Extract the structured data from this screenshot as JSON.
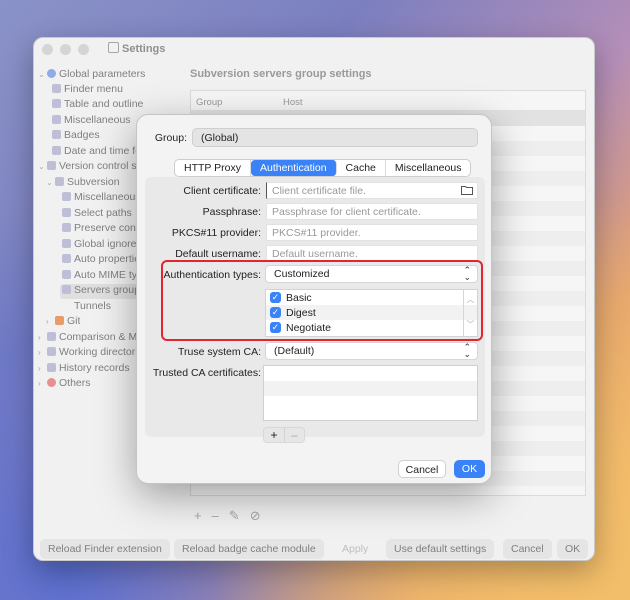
{
  "window": {
    "title": "Settings",
    "content_title": "Subversion servers group settings",
    "table_columns": [
      "Group",
      "Host"
    ],
    "table_tools": [
      "+",
      "–",
      "✎",
      "⊘"
    ]
  },
  "sidebar": {
    "items": [
      {
        "label": "Global parameters",
        "chevron": "⌄"
      },
      {
        "label": "Finder menu",
        "chevron": ""
      },
      {
        "label": "Table and outline",
        "chevron": ""
      },
      {
        "label": "Miscellaneous",
        "chevron": ""
      },
      {
        "label": "Badges",
        "chevron": ""
      },
      {
        "label": "Date and time fo",
        "chevron": ""
      },
      {
        "label": "Version control sy",
        "chevron": "⌄"
      },
      {
        "label": "Subversion",
        "chevron": "⌄"
      },
      {
        "label": "Miscellaneous",
        "chevron": ""
      },
      {
        "label": "Select paths",
        "chevron": ""
      },
      {
        "label": "Preserve conf",
        "chevron": ""
      },
      {
        "label": "Global ignore",
        "chevron": ""
      },
      {
        "label": "Auto propertie",
        "chevron": ""
      },
      {
        "label": "Auto MIME typ",
        "chevron": ""
      },
      {
        "label": "Servers group",
        "chevron": ""
      },
      {
        "label": "Tunnels",
        "chevron": ""
      },
      {
        "label": "Git",
        "chevron": "›"
      },
      {
        "label": "Comparison & Me",
        "chevron": "›"
      },
      {
        "label": "Working directorie",
        "chevron": "›"
      },
      {
        "label": "History records",
        "chevron": "›"
      },
      {
        "label": "Others",
        "chevron": "›"
      }
    ]
  },
  "bottom_bar": {
    "reload_finder": "Reload Finder extension",
    "reload_badge": "Reload badge cache module",
    "apply": "Apply",
    "use_default": "Use default settings",
    "cancel": "Cancel",
    "ok": "OK"
  },
  "sheet": {
    "group_label": "Group:",
    "group_value": "(Global)",
    "tabs": [
      "HTTP Proxy",
      "Authentication",
      "Cache",
      "Miscellaneous"
    ],
    "active_tab": "Authentication",
    "client_cert_label": "Client certificate:",
    "client_cert_placeholder": "Client certificate file.",
    "passphrase_label": "Passphrase:",
    "passphrase_placeholder": "Passphrase for client certificate.",
    "pkcs_label": "PKCS#11 provider:",
    "pkcs_placeholder": "PKCS#11 provider.",
    "username_label": "Default username:",
    "username_placeholder": "Default username.",
    "auth_types_label": "Authentication types:",
    "auth_types_value": "Customized",
    "auth_options": [
      {
        "label": "Basic",
        "checked": true
      },
      {
        "label": "Digest",
        "checked": true
      },
      {
        "label": "Negotiate",
        "checked": true
      }
    ],
    "trust_ca_label": "Truse system CA:",
    "trust_ca_value": "(Default)",
    "trusted_certs_label": "Trusted CA certificates:",
    "add": "+",
    "remove": "–",
    "cancel": "Cancel",
    "ok": "OK",
    "highlight_color": "#e0262e",
    "accent_color": "#3a82f7"
  }
}
